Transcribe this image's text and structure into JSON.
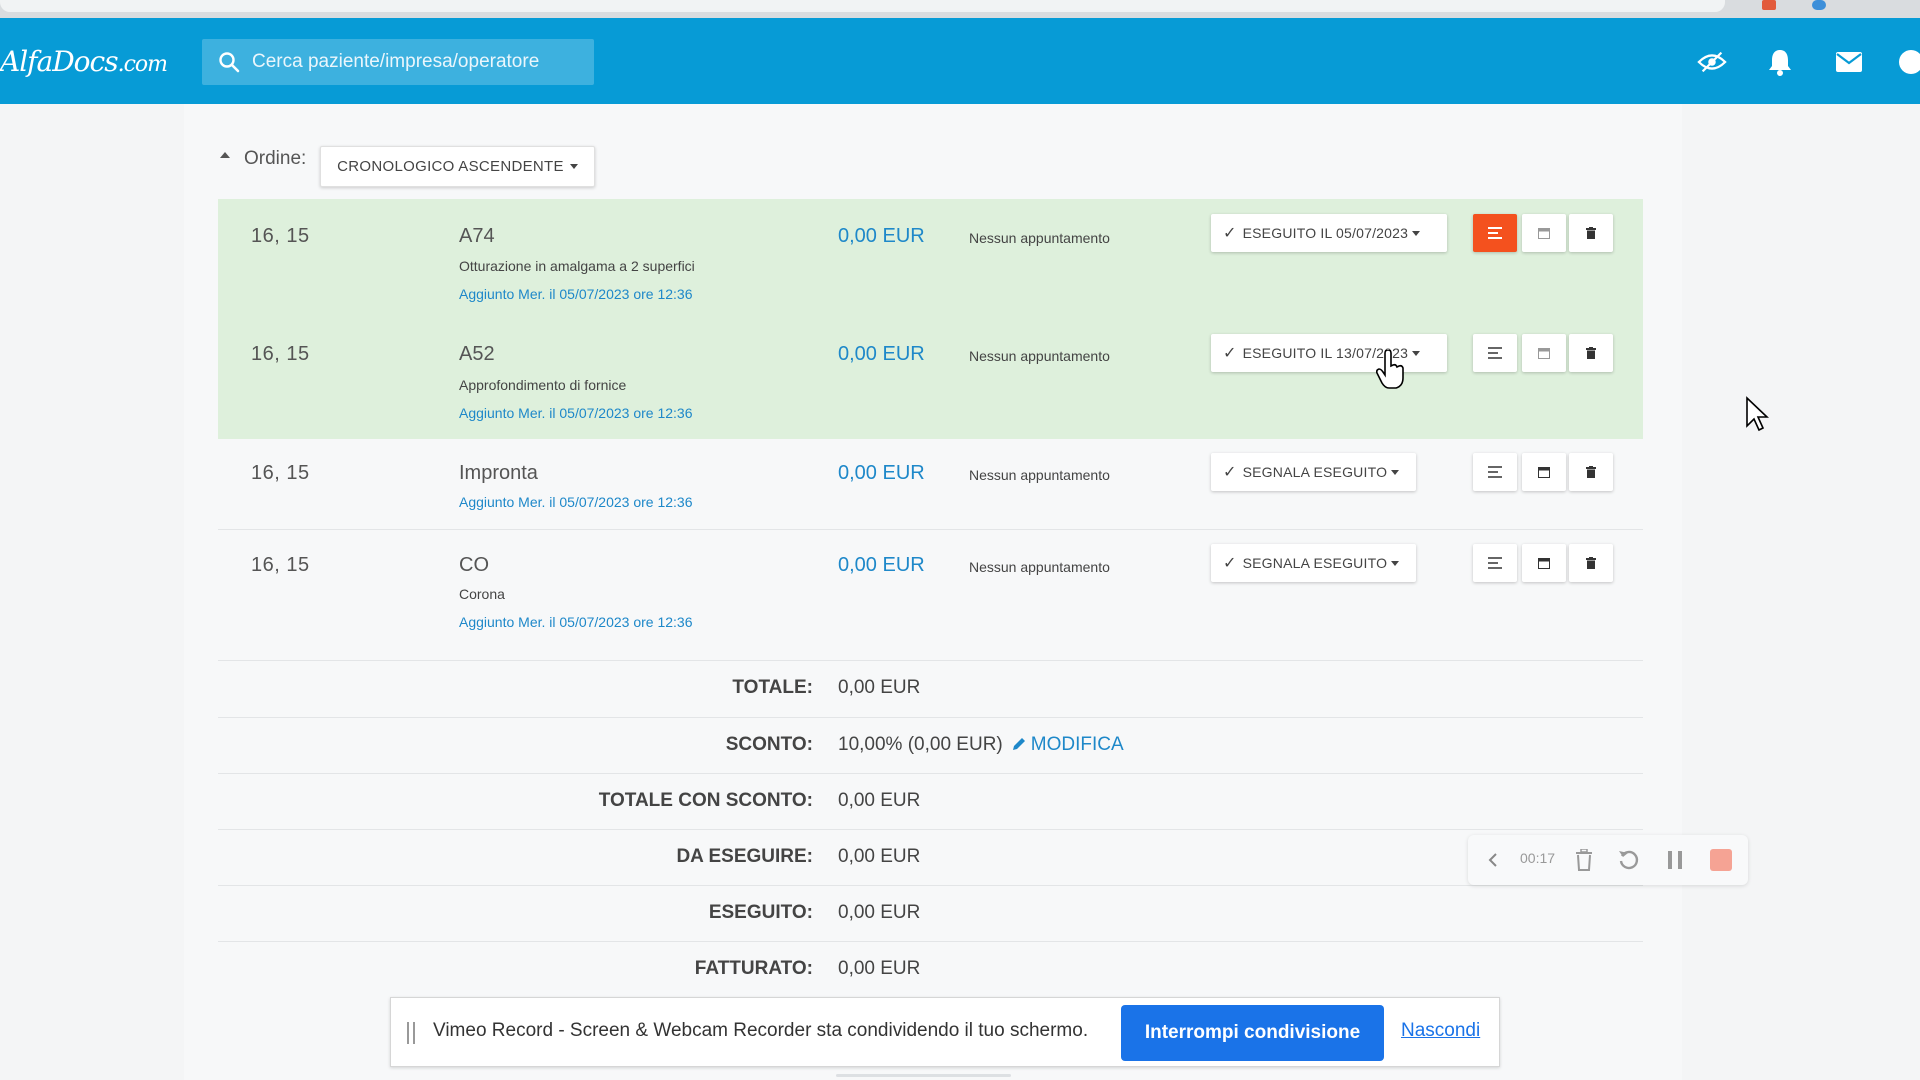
{
  "app": {
    "logo": "AlfaDocs",
    "logo_domain": ".com",
    "search_placeholder": "Cerca paziente/impresa/operatore",
    "accent_color": "#079bd6"
  },
  "order": {
    "label": "Ordine:",
    "value": "CRONOLOGICO ASCENDENTE"
  },
  "treatments": [
    {
      "tooth": "16, 15",
      "code": "A74",
      "description": "Otturazione in amalgama a 2 superfici",
      "added": "Aggiunto Mer. il 05/07/2023 ore 12:36",
      "price": "0,00 EUR",
      "appointment": "Nessun appuntamento",
      "status": "ESEGUITO IL 05/07/2023",
      "done": true
    },
    {
      "tooth": "16, 15",
      "code": "A52",
      "description": "Approfondimento di fornice",
      "added": "Aggiunto Mer. il 05/07/2023 ore 12:36",
      "price": "0,00 EUR",
      "appointment": "Nessun appuntamento",
      "status": "ESEGUITO IL 13/07/2023",
      "done": true
    },
    {
      "tooth": "16, 15",
      "code": "Impronta",
      "description": "",
      "added": "Aggiunto Mer. il 05/07/2023 ore 12:36",
      "price": "0,00 EUR",
      "appointment": "Nessun appuntamento",
      "status": "SEGNALA ESEGUITO",
      "done": false
    },
    {
      "tooth": "16, 15",
      "code": "CO",
      "description": "Corona",
      "added": "Aggiunto Mer. il 05/07/2023 ore 12:36",
      "price": "0,00 EUR",
      "appointment": "Nessun appuntamento",
      "status": "SEGNALA ESEGUITO",
      "done": false
    }
  ],
  "summary": {
    "totale_label": "TOTALE:",
    "totale_value": "0,00 EUR",
    "sconto_label": "SCONTO:",
    "sconto_value": "10,00% (0,00 EUR)",
    "modifica_label": "MODIFICA",
    "totale_sconto_label": "TOTALE CON SCONTO:",
    "totale_sconto_value": "0,00 EUR",
    "da_eseguire_label": "DA ESEGUIRE:",
    "da_eseguire_value": "0,00 EUR",
    "eseguito_label": "ESEGUITO:",
    "eseguito_value": "0,00 EUR",
    "fatturato_label": "FATTURATO:",
    "fatturato_value": "0,00 EUR"
  },
  "recorder": {
    "time": "00:17"
  },
  "share_bar": {
    "message": "Vimeo Record - Screen & Webcam Recorder sta condividendo il tuo schermo.",
    "stop_label": "Interrompi condivisione",
    "hide_label": "Nascondi"
  }
}
